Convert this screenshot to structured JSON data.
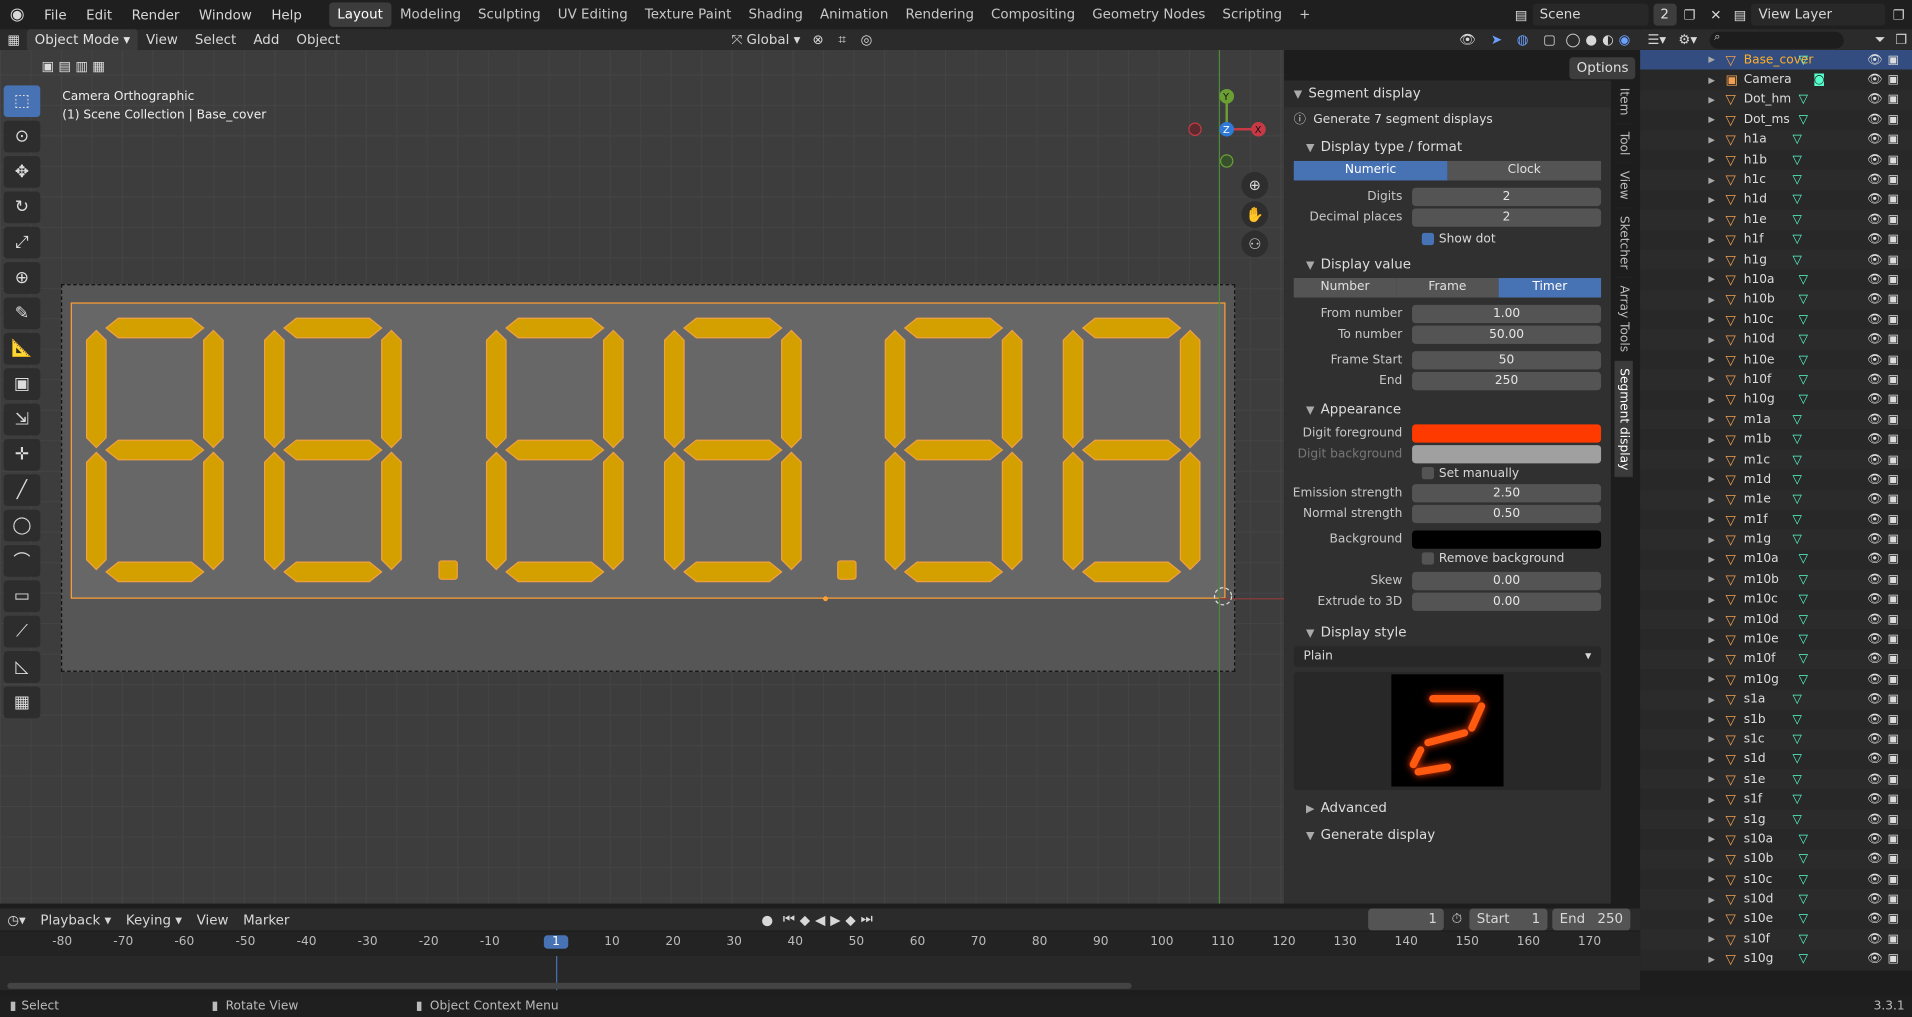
{
  "menus": [
    "File",
    "Edit",
    "Render",
    "Window",
    "Help"
  ],
  "workspaces": [
    {
      "label": "Layout",
      "active": true
    },
    {
      "label": "Modeling"
    },
    {
      "label": "Sculpting"
    },
    {
      "label": "UV Editing"
    },
    {
      "label": "Texture Paint"
    },
    {
      "label": "Shading"
    },
    {
      "label": "Animation"
    },
    {
      "label": "Rendering"
    },
    {
      "label": "Compositing"
    },
    {
      "label": "Geometry Nodes"
    },
    {
      "label": "Scripting"
    }
  ],
  "scene": {
    "name": "Scene",
    "users": "2"
  },
  "view_layer": "View Layer",
  "viewport_header": {
    "mode": "Object Mode",
    "menus": [
      "View",
      "Select",
      "Add",
      "Object"
    ],
    "orientation": "Global",
    "options": "Options"
  },
  "viewport_info": {
    "line1": "Camera Orthographic",
    "line2": "(1) Scene Collection | Base_cover"
  },
  "gizmo": {
    "y": "Y",
    "z": "Z",
    "x": "X"
  },
  "tabs": [
    "Item",
    "Tool",
    "View",
    "Sketcher",
    "Array Tools",
    "Segment display"
  ],
  "panel": {
    "title": "Segment display",
    "generate_label": "Generate 7 segment displays",
    "display_type": {
      "title": "Display type / format",
      "options": [
        "Numeric",
        "Clock"
      ],
      "active": "Numeric",
      "digits_label": "Digits",
      "digits": "2",
      "decimal_label": "Decimal places",
      "decimal": "2",
      "show_dot": "Show dot"
    },
    "display_value": {
      "title": "Display value",
      "options": [
        "Number",
        "Frame",
        "Timer"
      ],
      "active": "Timer",
      "from_label": "From number",
      "from": "1.00",
      "to_label": "To number",
      "to": "50.00",
      "frame_start_label": "Frame Start",
      "frame_start": "50",
      "end_label": "End",
      "end": "250"
    },
    "appearance": {
      "title": "Appearance",
      "fg_label": "Digit foreground",
      "fg_color": "#ff3a00",
      "bg_label": "Digit background",
      "bg_color": "#a0a0a0",
      "set_manually": "Set manually",
      "emission_label": "Emission strength",
      "emission": "2.50",
      "normal_label": "Normal strength",
      "normal": "0.50",
      "background_label": "Background",
      "background_color": "#000000",
      "remove_bg": "Remove background",
      "skew_label": "Skew",
      "skew": "0.00",
      "extrude_label": "Extrude to 3D",
      "extrude": "0.00"
    },
    "display_style": {
      "title": "Display style",
      "value": "Plain"
    },
    "advanced": "Advanced",
    "generate": "Generate display"
  },
  "outliner": [
    "Base_cover",
    "Camera",
    "Dot_hm",
    "Dot_ms",
    "h1a",
    "h1b",
    "h1c",
    "h1d",
    "h1e",
    "h1f",
    "h1g",
    "h10a",
    "h10b",
    "h10c",
    "h10d",
    "h10e",
    "h10f",
    "h10g",
    "m1a",
    "m1b",
    "m1c",
    "m1d",
    "m1e",
    "m1f",
    "m1g",
    "m10a",
    "m10b",
    "m10c",
    "m10d",
    "m10e",
    "m10f",
    "m10g",
    "s1a",
    "s1b",
    "s1c",
    "s1d",
    "s1e",
    "s1f",
    "s1g",
    "s10a",
    "s10b",
    "s10c",
    "s10d",
    "s10e",
    "s10f",
    "s10g"
  ],
  "timeline": {
    "menus": [
      "Playback",
      "Keying",
      "View",
      "Marker"
    ],
    "current_frame": "1",
    "start_label": "Start",
    "start": "1",
    "end_label": "End",
    "end": "250",
    "ticks": [
      "-80",
      "-70",
      "-60",
      "-50",
      "-40",
      "-30",
      "-20",
      "-10",
      "1",
      "10",
      "20",
      "30",
      "40",
      "50",
      "60",
      "70",
      "80",
      "90",
      "100",
      "110",
      "120",
      "130",
      "140",
      "150",
      "160",
      "170"
    ]
  },
  "status": {
    "select": "Select",
    "rotate": "Rotate View",
    "context": "Object Context Menu",
    "version": "3.3.1"
  }
}
